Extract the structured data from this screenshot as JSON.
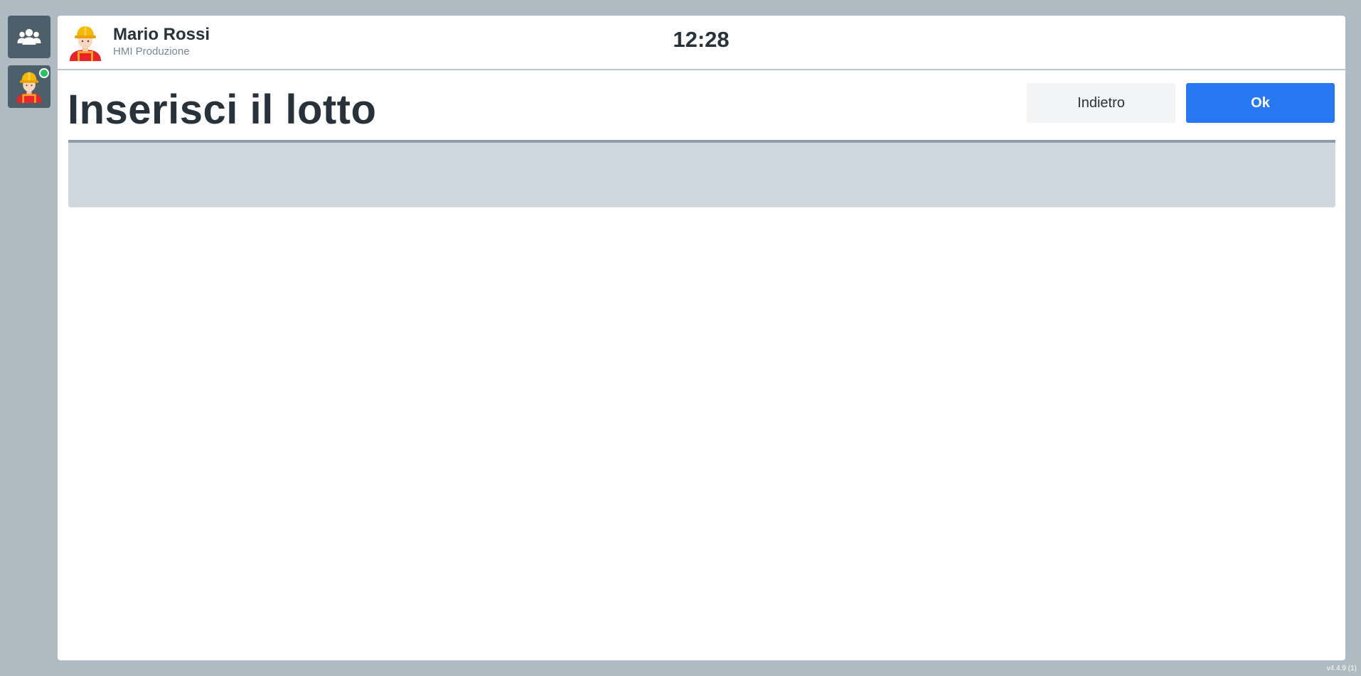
{
  "sidebar": {
    "items": [
      {
        "name": "users",
        "icon": "users-group-icon"
      },
      {
        "name": "operator",
        "icon": "worker-avatar-icon",
        "status": "online",
        "status_color": "#22c55e"
      }
    ]
  },
  "header": {
    "user_name": "Mario Rossi",
    "user_role": "HMI Produzione",
    "clock": "12:28"
  },
  "main": {
    "title": "Inserisci il lotto",
    "back_label": "Indietro",
    "ok_label": "Ok",
    "lot_input_value": ""
  },
  "footer": {
    "version": "v4.4.9 (1)"
  },
  "colors": {
    "background": "#aebbc2",
    "rail": "#4d5f6a",
    "accent": "#2878f4",
    "input": "#d0d8df"
  }
}
